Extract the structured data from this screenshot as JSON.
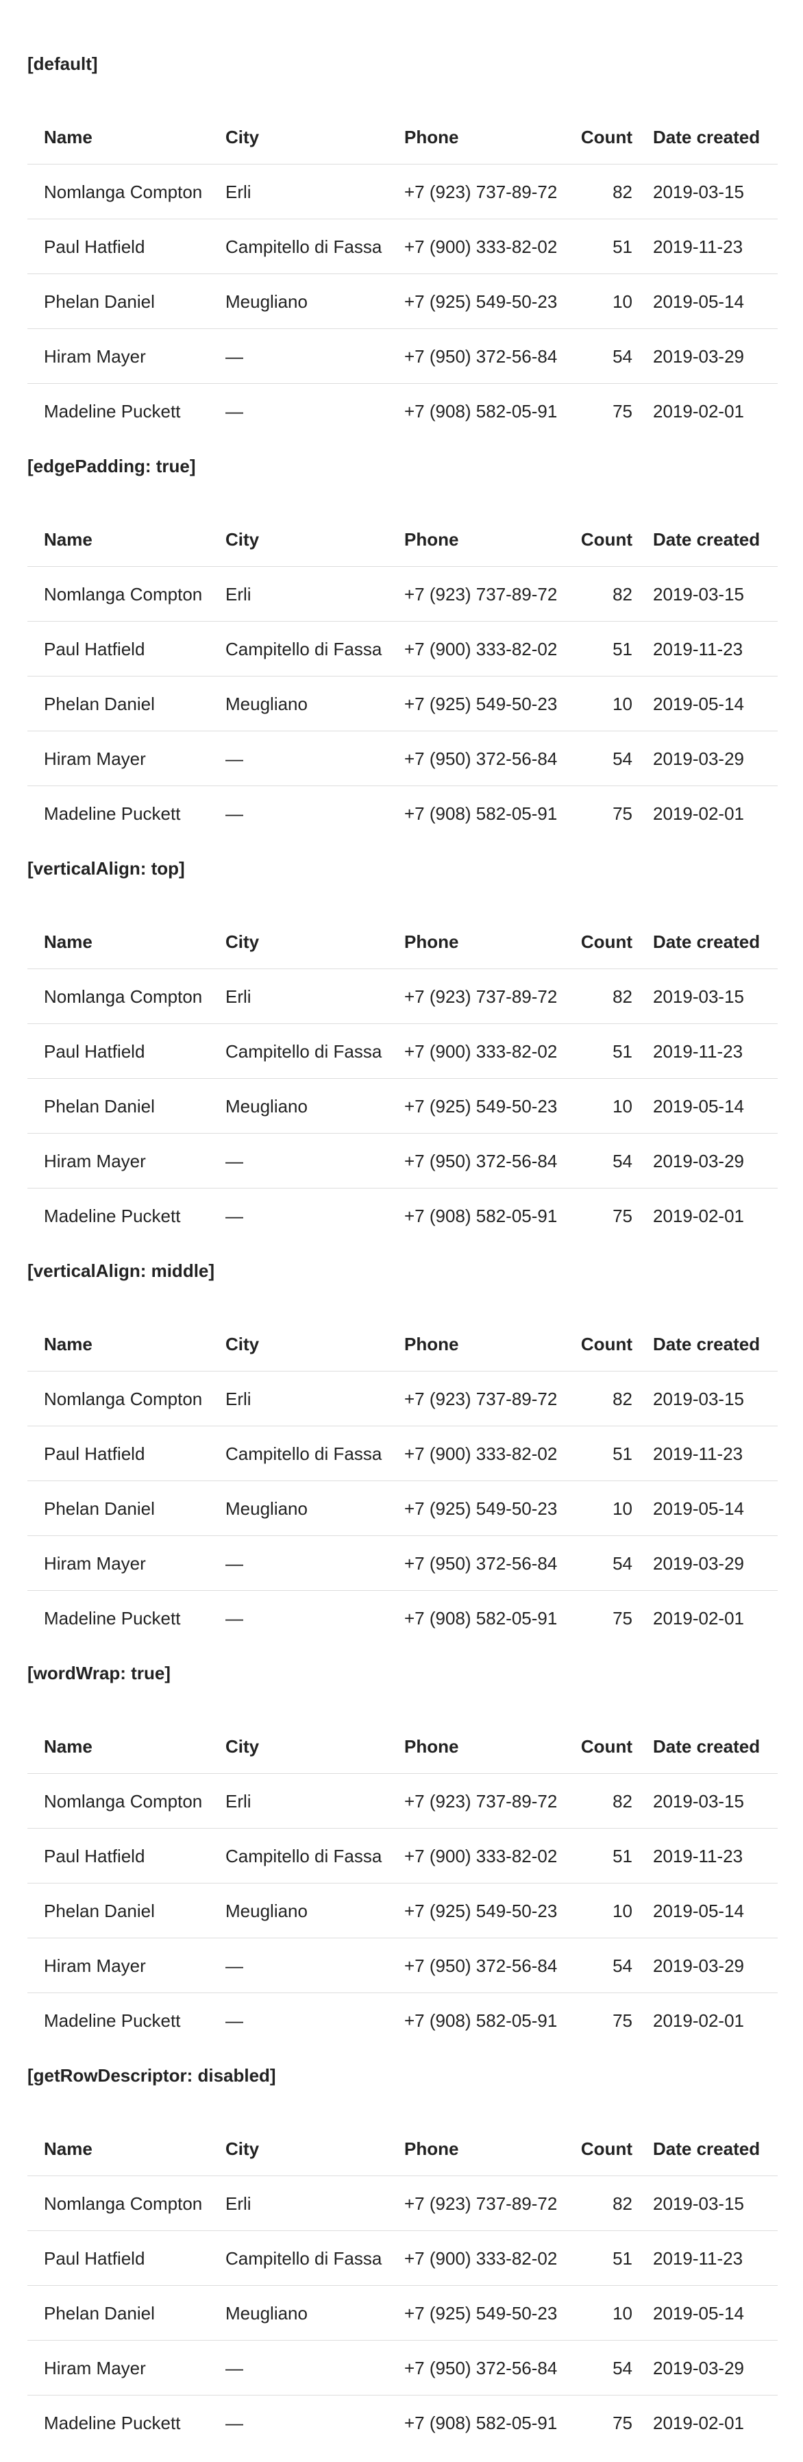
{
  "columns": {
    "name": "Name",
    "city": "City",
    "phone": "Phone",
    "count": "Count",
    "date": "Date created"
  },
  "rows": [
    {
      "name": "Nomlanga Compton",
      "city": "Erli",
      "phone": "+7 (923) 737-89-72",
      "count": "82",
      "date": "2019-03-15"
    },
    {
      "name": "Paul Hatfield",
      "city": "Campitello di Fassa",
      "phone": "+7 (900) 333-82-02",
      "count": "51",
      "date": "2019-11-23"
    },
    {
      "name": "Phelan Daniel",
      "city": "Meugliano",
      "phone": "+7 (925) 549-50-23",
      "count": "10",
      "date": "2019-05-14"
    },
    {
      "name": "Hiram Mayer",
      "city": "—",
      "phone": "+7 (950) 372-56-84",
      "count": "54",
      "date": "2019-03-29"
    },
    {
      "name": "Madeline Puckett",
      "city": "—",
      "phone": "+7 (908) 582-05-91",
      "count": "75",
      "date": "2019-02-01"
    }
  ],
  "sections": [
    {
      "title": "[default]"
    },
    {
      "title": "[edgePadding: true]"
    },
    {
      "title": "[verticalAlign: top]"
    },
    {
      "title": "[verticalAlign: middle]"
    },
    {
      "title": "[wordWrap: true]"
    },
    {
      "title": "[getRowDescriptor: disabled]"
    }
  ]
}
